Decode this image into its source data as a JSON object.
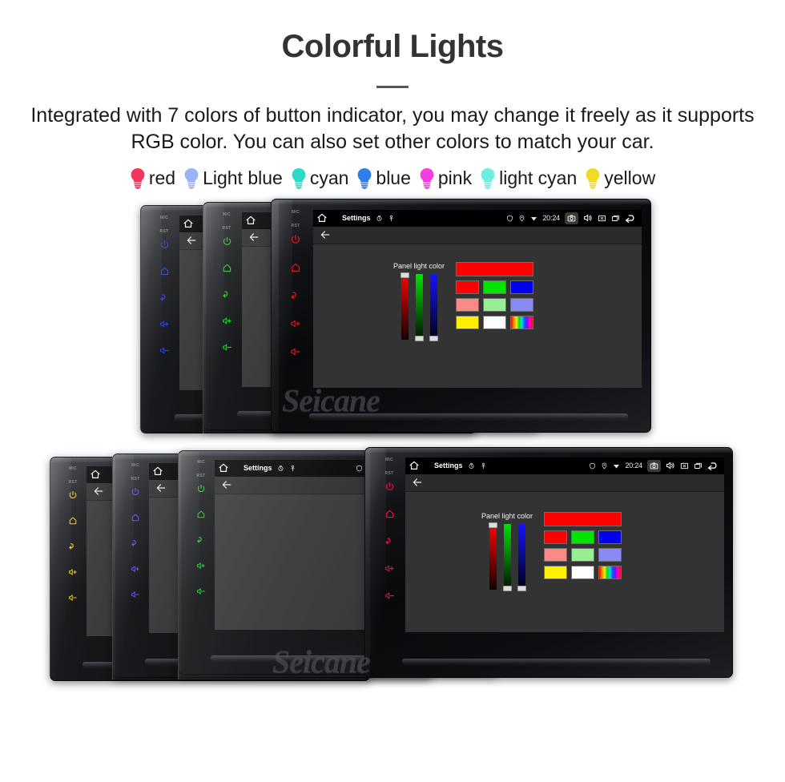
{
  "header": {
    "title": "Colorful Lights",
    "subtitle": "Integrated with 7 colors of button indicator, you may change it freely as it supports RGB color. You can also set other colors to match your car."
  },
  "legend": {
    "items": [
      {
        "label": "red",
        "color": "#F0355F"
      },
      {
        "label": "Light blue",
        "color": "#9BB4F5"
      },
      {
        "label": "cyan",
        "color": "#2DD9C8"
      },
      {
        "label": "blue",
        "color": "#2E7FE8"
      },
      {
        "label": "pink",
        "color": "#F53EE0"
      },
      {
        "label": "light cyan",
        "color": "#6EEDE0"
      },
      {
        "label": "yellow",
        "color": "#F0DC28"
      }
    ]
  },
  "device": {
    "brand_watermark": "Seicane",
    "side_buttons": {
      "mic_label": "MIC",
      "rst_label": "RST",
      "icons": [
        "power-icon",
        "home-icon",
        "back-icon",
        "volume-up-icon",
        "volume-down-icon"
      ]
    },
    "statusbar": {
      "home_icon": "home-icon",
      "title": "Settings",
      "left_icons": [
        "rotation-icon",
        "pin-icon"
      ],
      "right_icons": [
        "shield-icon",
        "location-icon",
        "wifi-icon"
      ],
      "time": "20:24",
      "tray_icons": [
        "camera-icon",
        "volume-icon",
        "close-box-icon",
        "recents-icon",
        "back-loop-icon"
      ]
    },
    "toolbar": {
      "back_icon": "arrow-left-icon"
    },
    "dialog": {
      "label": "Panel light color",
      "sliders": [
        {
          "name": "red-slider",
          "top_color": "#FF0000",
          "bottom_color": "#120000",
          "thumb_pos": "top"
        },
        {
          "name": "green-slider",
          "top_color": "#00E000",
          "bottom_color": "#001200",
          "thumb_pos": "bottom"
        },
        {
          "name": "blue-slider",
          "top_color": "#1414FF",
          "bottom_color": "#000014",
          "thumb_pos": "bottom"
        }
      ],
      "preview_color": "#FF0000",
      "swatch_grid": [
        [
          "#FF0000",
          "#00E500",
          "#0000EE"
        ],
        [
          "#FA8A86",
          "#98EE92",
          "#8A8AF5"
        ],
        [
          "#FFF000",
          "#FFFFFF",
          "rainbow"
        ]
      ]
    }
  },
  "units": {
    "top_row": [
      {
        "name": "unit-top-1",
        "button_color": "#1F33E0"
      },
      {
        "name": "unit-top-2",
        "button_color": "#18C81E"
      },
      {
        "name": "unit-top-3",
        "button_color": "#E01414"
      }
    ],
    "bottom_row": [
      {
        "name": "unit-bottom-1",
        "button_color": "#E5C31A"
      },
      {
        "name": "unit-bottom-2",
        "button_color": "#5B47E8"
      },
      {
        "name": "unit-bottom-3",
        "button_color": "#18C81E"
      },
      {
        "name": "unit-bottom-4",
        "button_color": "#E01442"
      }
    ]
  }
}
